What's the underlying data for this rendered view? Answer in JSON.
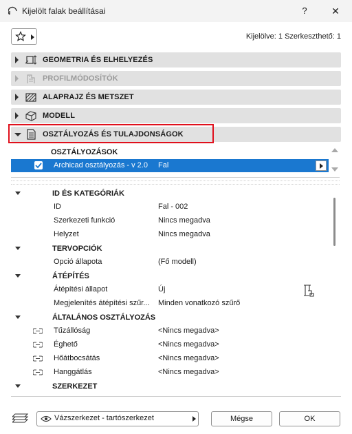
{
  "window": {
    "title": "Kijelölt falak beállításai",
    "help": "?",
    "close": "✕"
  },
  "toolbar": {
    "selection_info": "Kijelölve: 1 Szerkeszthető: 1"
  },
  "sections": [
    {
      "label": "GEOMETRIA ÉS ELHELYEZÉS",
      "icon": "geometry-icon",
      "expanded": false,
      "disabled": false
    },
    {
      "label": "PROFILMÓDOSÍTÓK",
      "icon": "profile-modifier-icon",
      "expanded": false,
      "disabled": true
    },
    {
      "label": "ALAPRAJZ ÉS METSZET",
      "icon": "floorplan-section-icon",
      "expanded": false,
      "disabled": false
    },
    {
      "label": "MODELL",
      "icon": "model-cube-icon",
      "expanded": false,
      "disabled": false
    },
    {
      "label": "OSZTÁLYOZÁS ÉS TULAJDONSÁGOK",
      "icon": "document-icon",
      "expanded": true,
      "disabled": false
    }
  ],
  "classifications": {
    "header": "OSZTÁLYOZÁSOK",
    "row": {
      "name": "Archicad osztályozás - v 2.0",
      "value": "Fal",
      "checked": true
    }
  },
  "properties": [
    {
      "type": "group",
      "label": "ID ÉS KATEGÓRIÁK"
    },
    {
      "type": "prop",
      "name": "ID",
      "value": "Fal - 002"
    },
    {
      "type": "prop",
      "name": "Szerkezeti funkció",
      "value": "Nincs megadva"
    },
    {
      "type": "prop",
      "name": "Helyzet",
      "value": "Nincs megadva"
    },
    {
      "type": "group",
      "label": "TERVOPCIÓK"
    },
    {
      "type": "prop",
      "name": "Opció állapota",
      "value": "(Fő modell)"
    },
    {
      "type": "group",
      "label": "ÁTÉPÍTÉS"
    },
    {
      "type": "prop",
      "name": "Átépítési állapot",
      "value": "Új"
    },
    {
      "type": "prop",
      "name": "Megjelenítés átépítési szűr...",
      "value": "Minden vonatkozó szűrő"
    },
    {
      "type": "group",
      "label": "ÁLTALÁNOS OSZTÁLYOZÁS"
    },
    {
      "type": "prop",
      "name": "Tűzállóság",
      "value": "<Nincs megadva>",
      "linked": true
    },
    {
      "type": "prop",
      "name": "Éghető",
      "value": "<Nincs megadva>",
      "linked": true
    },
    {
      "type": "prop",
      "name": "Hőátbocsátás",
      "value": "<Nincs megadva>",
      "linked": true
    },
    {
      "type": "prop",
      "name": "Hanggátlás",
      "value": "<Nincs megadva>",
      "linked": true
    },
    {
      "type": "group",
      "label": "SZERKEZET"
    }
  ],
  "footer": {
    "layer": "Vázszerkezet - tartószerkezet",
    "cancel": "Mégse",
    "ok": "OK"
  },
  "colors": {
    "selection": "#1a78d0",
    "highlight": "#e0101c",
    "section_bg": "#e1e1e1"
  }
}
